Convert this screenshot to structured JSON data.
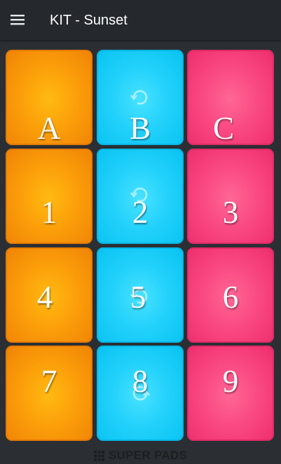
{
  "app_bar": {
    "title": "KIT - Sunset",
    "menu_icon": "hamburger-menu-icon"
  },
  "colors": {
    "background": "#2b2f33",
    "app_bar": "#25292d",
    "orange_pad": "#fca00a",
    "blue_pad": "#24d2fb",
    "pink_pad": "#fa4a83"
  },
  "pads": [
    {
      "label": "A",
      "color": "orange",
      "loop_icon": false
    },
    {
      "label": "B",
      "color": "blue",
      "loop_icon": true
    },
    {
      "label": "C",
      "color": "pink",
      "loop_icon": false
    },
    {
      "label": "1",
      "color": "orange",
      "loop_icon": false
    },
    {
      "label": "2",
      "color": "blue",
      "loop_icon": true
    },
    {
      "label": "3",
      "color": "pink",
      "loop_icon": false
    },
    {
      "label": "4",
      "color": "orange",
      "loop_icon": false
    },
    {
      "label": "5",
      "color": "blue",
      "loop_icon": true
    },
    {
      "label": "6",
      "color": "pink",
      "loop_icon": false
    },
    {
      "label": "7",
      "color": "orange",
      "loop_icon": false
    },
    {
      "label": "8",
      "color": "blue",
      "loop_icon": true
    },
    {
      "label": "9",
      "color": "pink",
      "loop_icon": false
    }
  ],
  "footer": {
    "brand": "SUPER PADS",
    "logo_icon": "grid-logo-icon"
  }
}
